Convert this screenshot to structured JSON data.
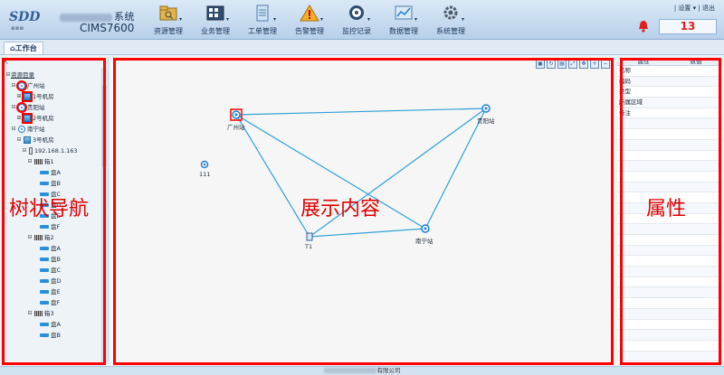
{
  "header": {
    "system_suffix": "系统",
    "product": "CIMS7600",
    "nav": [
      {
        "label": "资源管理",
        "icon": "resource-icon"
      },
      {
        "label": "业务管理",
        "icon": "business-icon"
      },
      {
        "label": "工单管理",
        "icon": "workorder-icon"
      },
      {
        "label": "告警管理",
        "icon": "alarm-icon"
      },
      {
        "label": "监控记录",
        "icon": "monitor-icon"
      },
      {
        "label": "数据管理",
        "icon": "data-icon"
      },
      {
        "label": "系统管理",
        "icon": "settings-icon"
      }
    ],
    "settings_link": "设置",
    "logout_link": "退出",
    "alarm_count": "13"
  },
  "tabs": {
    "active": "工作台"
  },
  "tree": {
    "root": "资源目录",
    "items": [
      {
        "label": "广州站",
        "level": 1,
        "icon": "station",
        "exp": "⊟",
        "red": true
      },
      {
        "label": "1号机房",
        "level": 2,
        "icon": "room",
        "exp": "⊞",
        "red": true
      },
      {
        "label": "贵阳站",
        "level": 1,
        "icon": "station",
        "exp": "⊟",
        "red": true
      },
      {
        "label": "2号机房",
        "level": 2,
        "icon": "room",
        "exp": "⊞",
        "red": true
      },
      {
        "label": "南宁站",
        "level": 1,
        "icon": "station",
        "exp": "⊟",
        "red": false
      },
      {
        "label": "3号机房",
        "level": 2,
        "icon": "room",
        "exp": "⊟",
        "red": false
      },
      {
        "label": "192.168.1.163",
        "level": 3,
        "icon": "dev",
        "exp": "⊟",
        "red": false
      },
      {
        "label": "箱1",
        "level": 4,
        "icon": "shelf",
        "exp": "⊟",
        "red": false
      },
      {
        "label": "盘A",
        "level": 5,
        "icon": "disk",
        "exp": "",
        "red": false
      },
      {
        "label": "盘B",
        "level": 5,
        "icon": "disk",
        "exp": "",
        "red": false
      },
      {
        "label": "盘C",
        "level": 5,
        "icon": "disk",
        "exp": "",
        "red": false
      },
      {
        "label": "盘D",
        "level": 5,
        "icon": "disk",
        "exp": "",
        "red": false
      },
      {
        "label": "盘E",
        "level": 5,
        "icon": "disk",
        "exp": "",
        "red": false
      },
      {
        "label": "盘F",
        "level": 5,
        "icon": "disk",
        "exp": "",
        "red": false
      },
      {
        "label": "箱2",
        "level": 4,
        "icon": "shelf",
        "exp": "⊟",
        "red": false
      },
      {
        "label": "盘A",
        "level": 5,
        "icon": "disk",
        "exp": "",
        "red": false
      },
      {
        "label": "盘B",
        "level": 5,
        "icon": "disk",
        "exp": "",
        "red": false
      },
      {
        "label": "盘C",
        "level": 5,
        "icon": "disk",
        "exp": "",
        "red": false
      },
      {
        "label": "盘D",
        "level": 5,
        "icon": "disk",
        "exp": "",
        "red": false
      },
      {
        "label": "盘E",
        "level": 5,
        "icon": "disk",
        "exp": "",
        "red": false
      },
      {
        "label": "盘F",
        "level": 5,
        "icon": "disk",
        "exp": "",
        "red": false
      },
      {
        "label": "箱3",
        "level": 4,
        "icon": "shelf",
        "exp": "⊟",
        "red": false
      },
      {
        "label": "盘A",
        "level": 5,
        "icon": "disk",
        "exp": "",
        "red": false
      },
      {
        "label": "盘B",
        "level": 5,
        "icon": "disk",
        "exp": "",
        "red": false
      }
    ]
  },
  "topology": {
    "nodes": {
      "guangzhou": "广州站",
      "guiyang": "贵阳站",
      "nanning": "南宁站",
      "t1": "T1",
      "n111": "111"
    },
    "toolbar": [
      "save",
      "refresh",
      "export",
      "fit",
      "move",
      "zoom-in",
      "zoom-out"
    ]
  },
  "annotations": {
    "left": "树状导航",
    "center": "展示内容",
    "right": "属性"
  },
  "properties": {
    "col_attr": "属性",
    "col_value": "数值",
    "rows": [
      "名称",
      "编码",
      "类型",
      "所属区域",
      "备注"
    ]
  },
  "footer": {
    "suffix": "有限公司"
  },
  "colors": {
    "accent": "#1f7fd0",
    "alert": "#e02020",
    "frame": "#ff0000",
    "link": "#2fa0d6"
  }
}
